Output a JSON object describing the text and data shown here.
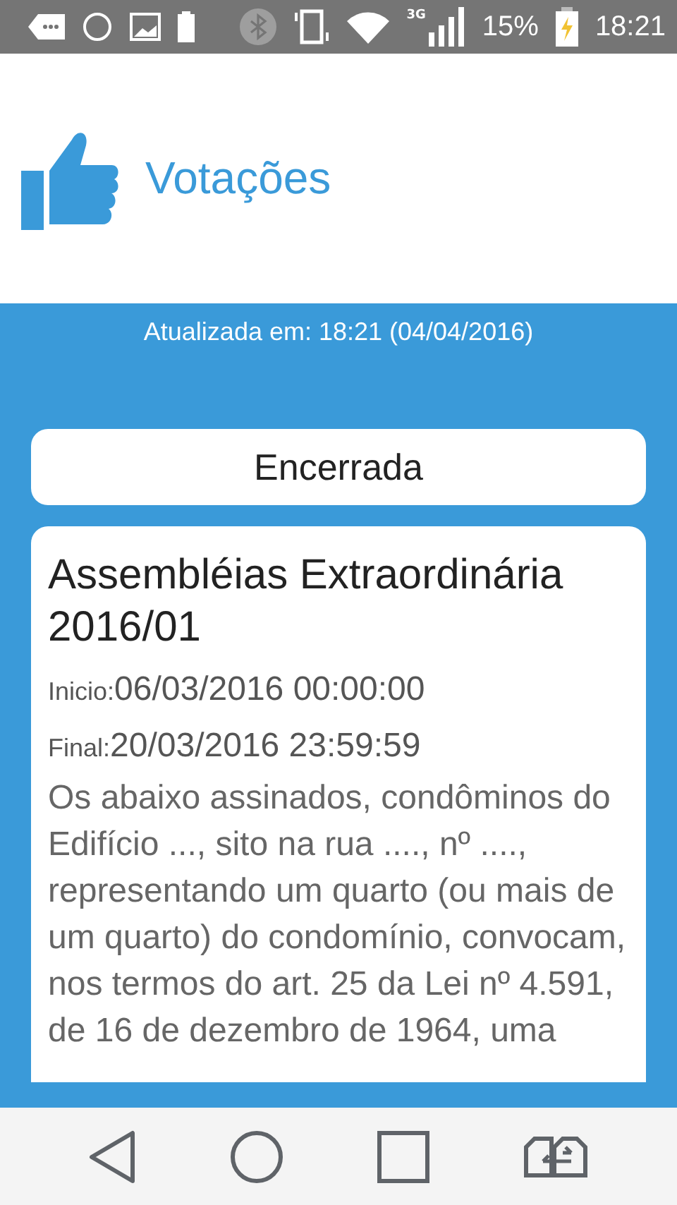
{
  "status_bar": {
    "network": "3G",
    "battery": "15%",
    "time": "18:21"
  },
  "header": {
    "title": "Votações"
  },
  "updated": "Atualizada em: 18:21 (04/04/2016)",
  "state_label": "Encerrada",
  "vote": {
    "title": "Assembléias Extraordinária 2016/01",
    "start_label": "Inicio:",
    "start": "06/03/2016 00:00:00",
    "end_label": "Final:",
    "end": "20/03/2016 23:59:59",
    "description": "Os abaixo assinados, condôminos do Edifício ..., sito na rua ...., nº ...., representando um quarto (ou mais de um quarto) do condomínio, convocam, nos termos do art. 25 da Lei nº 4.591, de 16 de dezembro de 1964, uma"
  }
}
